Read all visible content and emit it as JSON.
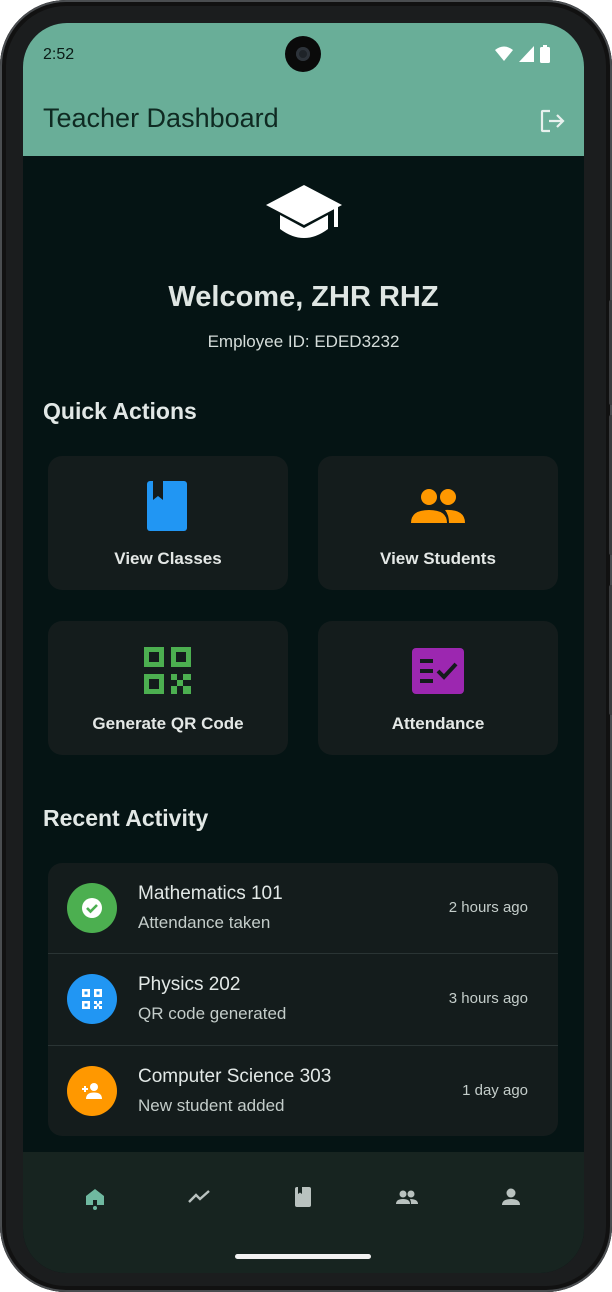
{
  "status_bar": {
    "time": "2:52"
  },
  "app_bar": {
    "title": "Teacher Dashboard",
    "logout_icon": "logout-icon"
  },
  "header": {
    "icon": "graduation-cap-icon",
    "welcome": "Welcome, ZHR RHZ",
    "employee_id": "Employee ID: EDED3232"
  },
  "quick_actions": {
    "heading": "Quick Actions",
    "items": [
      {
        "label": "View Classes",
        "icon": "book-icon",
        "color": "#2196f3"
      },
      {
        "label": "View Students",
        "icon": "people-icon",
        "color": "#ff9800"
      },
      {
        "label": "Generate QR Code",
        "icon": "qr-code-icon",
        "color": "#4caf50"
      },
      {
        "label": "Attendance",
        "icon": "fact-check-icon",
        "color": "#9c27b0"
      }
    ]
  },
  "recent_activity": {
    "heading": "Recent Activity",
    "items": [
      {
        "title": "Mathematics 101",
        "subtitle": "Attendance taken",
        "time": "2 hours ago",
        "icon": "check-circle-icon",
        "color": "#4caf50"
      },
      {
        "title": "Physics 202",
        "subtitle": "QR code generated",
        "time": "3 hours ago",
        "icon": "qr-code-icon",
        "color": "#2196f3"
      },
      {
        "title": "Computer Science 303",
        "subtitle": "New student added",
        "time": "1 day ago",
        "icon": "person-add-icon",
        "color": "#ff9800"
      }
    ]
  },
  "bottom_nav": {
    "items": [
      {
        "icon": "home-icon",
        "active": true
      },
      {
        "icon": "trending-icon",
        "active": false
      },
      {
        "icon": "book-icon",
        "active": false
      },
      {
        "icon": "people-icon",
        "active": false
      },
      {
        "icon": "person-icon",
        "active": false
      }
    ],
    "active_color": "#6fb9a0",
    "inactive_color": "#b9c2bf"
  },
  "colors": {
    "app_bar": "#69ae98",
    "background": "#051414",
    "card": "#141c1c"
  }
}
